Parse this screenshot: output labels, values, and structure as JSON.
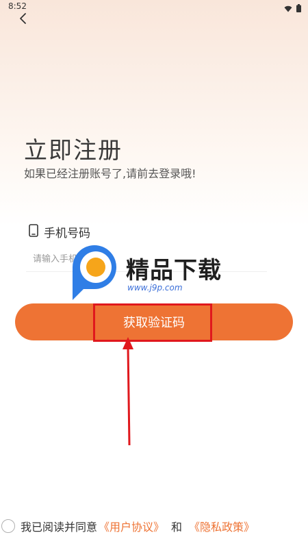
{
  "status_bar": {
    "time": "8:52"
  },
  "header": {
    "title": "立即注册",
    "subtitle": "如果已经注册账号了,请前去登录哦!"
  },
  "form": {
    "phone_label": "手机号码",
    "phone_placeholder": "请输入手机号",
    "submit_label": "获取验证码"
  },
  "watermark": {
    "title": "精品下载",
    "url": "www.j9p.com"
  },
  "agreement": {
    "prefix": "我已阅读并同意",
    "user_agreement": "《用户协议》",
    "and": "和",
    "privacy_policy": "《隐私政策》"
  },
  "colors": {
    "accent": "#ee7334",
    "annotation": "#e0181d"
  }
}
